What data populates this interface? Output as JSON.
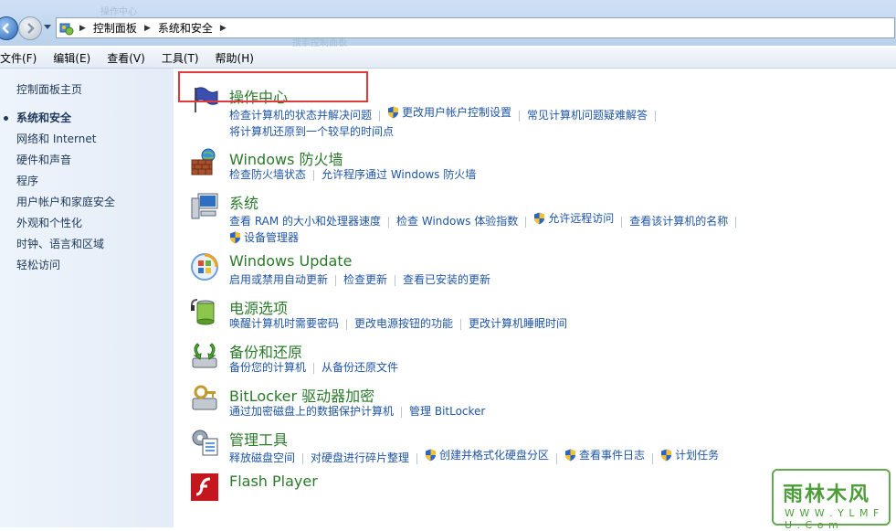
{
  "window": {
    "ghost_title_text": "操作中心",
    "ghost_search_text": "搜索控制面板"
  },
  "address": {
    "crumbs": [
      "控制面板",
      "系统和安全"
    ]
  },
  "menu": [
    "文件(F)",
    "编辑(E)",
    "查看(V)",
    "工具(T)",
    "帮助(H)"
  ],
  "sidebar": {
    "home": "控制面板主页",
    "items": [
      {
        "label": "系统和安全",
        "active": true
      },
      {
        "label": "网络和 Internet"
      },
      {
        "label": "硬件和声音"
      },
      {
        "label": "程序"
      },
      {
        "label": "用户帐户和家庭安全"
      },
      {
        "label": "外观和个性化"
      },
      {
        "label": "时钟、语言和区域"
      },
      {
        "label": "轻松访问"
      }
    ]
  },
  "sections": [
    {
      "title": "操作中心",
      "icon": "flag-icon",
      "links": [
        {
          "text": "检查计算机的状态并解决问题"
        },
        {
          "text": "更改用户帐户控制设置",
          "shield": true
        },
        {
          "text": "常见计算机问题疑难解答"
        },
        {
          "text": "将计算机还原到一个较早的时间点"
        }
      ]
    },
    {
      "title": "Windows 防火墙",
      "icon": "firewall-icon",
      "links": [
        {
          "text": "检查防火墙状态"
        },
        {
          "text": "允许程序通过 Windows 防火墙"
        }
      ]
    },
    {
      "title": "系统",
      "icon": "system-icon",
      "links": [
        {
          "text": "查看 RAM 的大小和处理器速度"
        },
        {
          "text": "检查 Windows 体验指数"
        },
        {
          "text": "允许远程访问",
          "shield": true
        },
        {
          "text": "查看该计算机的名称"
        },
        {
          "text": "设备管理器",
          "shield": true
        }
      ]
    },
    {
      "title": "Windows Update",
      "icon": "windows-update-icon",
      "links": [
        {
          "text": "启用或禁用自动更新"
        },
        {
          "text": "检查更新"
        },
        {
          "text": "查看已安装的更新"
        }
      ]
    },
    {
      "title": "电源选项",
      "icon": "power-options-icon",
      "links": [
        {
          "text": "唤醒计算机时需要密码"
        },
        {
          "text": "更改电源按钮的功能"
        },
        {
          "text": "更改计算机睡眠时间"
        }
      ]
    },
    {
      "title": "备份和还原",
      "icon": "backup-restore-icon",
      "links": [
        {
          "text": "备份您的计算机"
        },
        {
          "text": "从备份还原文件"
        }
      ]
    },
    {
      "title": "BitLocker 驱动器加密",
      "icon": "bitlocker-icon",
      "links": [
        {
          "text": "通过加密磁盘上的数据保护计算机"
        },
        {
          "text": "管理 BitLocker"
        }
      ]
    },
    {
      "title": "管理工具",
      "icon": "admin-tools-icon",
      "links": [
        {
          "text": "释放磁盘空间"
        },
        {
          "text": "对硬盘进行碎片整理"
        },
        {
          "text": "创建并格式化硬盘分区",
          "shield": true
        },
        {
          "text": "查看事件日志",
          "shield": true
        },
        {
          "text": "计划任务",
          "shield": true
        }
      ]
    },
    {
      "title": "Flash Player",
      "icon": "flash-player-icon",
      "links": []
    }
  ],
  "watermark": {
    "main": "雨林木风",
    "sub": "W W W . Y L M F U . C o m"
  },
  "colors": {
    "title_green": "#2b7a2b",
    "link_blue": "#1f55a5",
    "highlight_red": "#e03a3a"
  }
}
